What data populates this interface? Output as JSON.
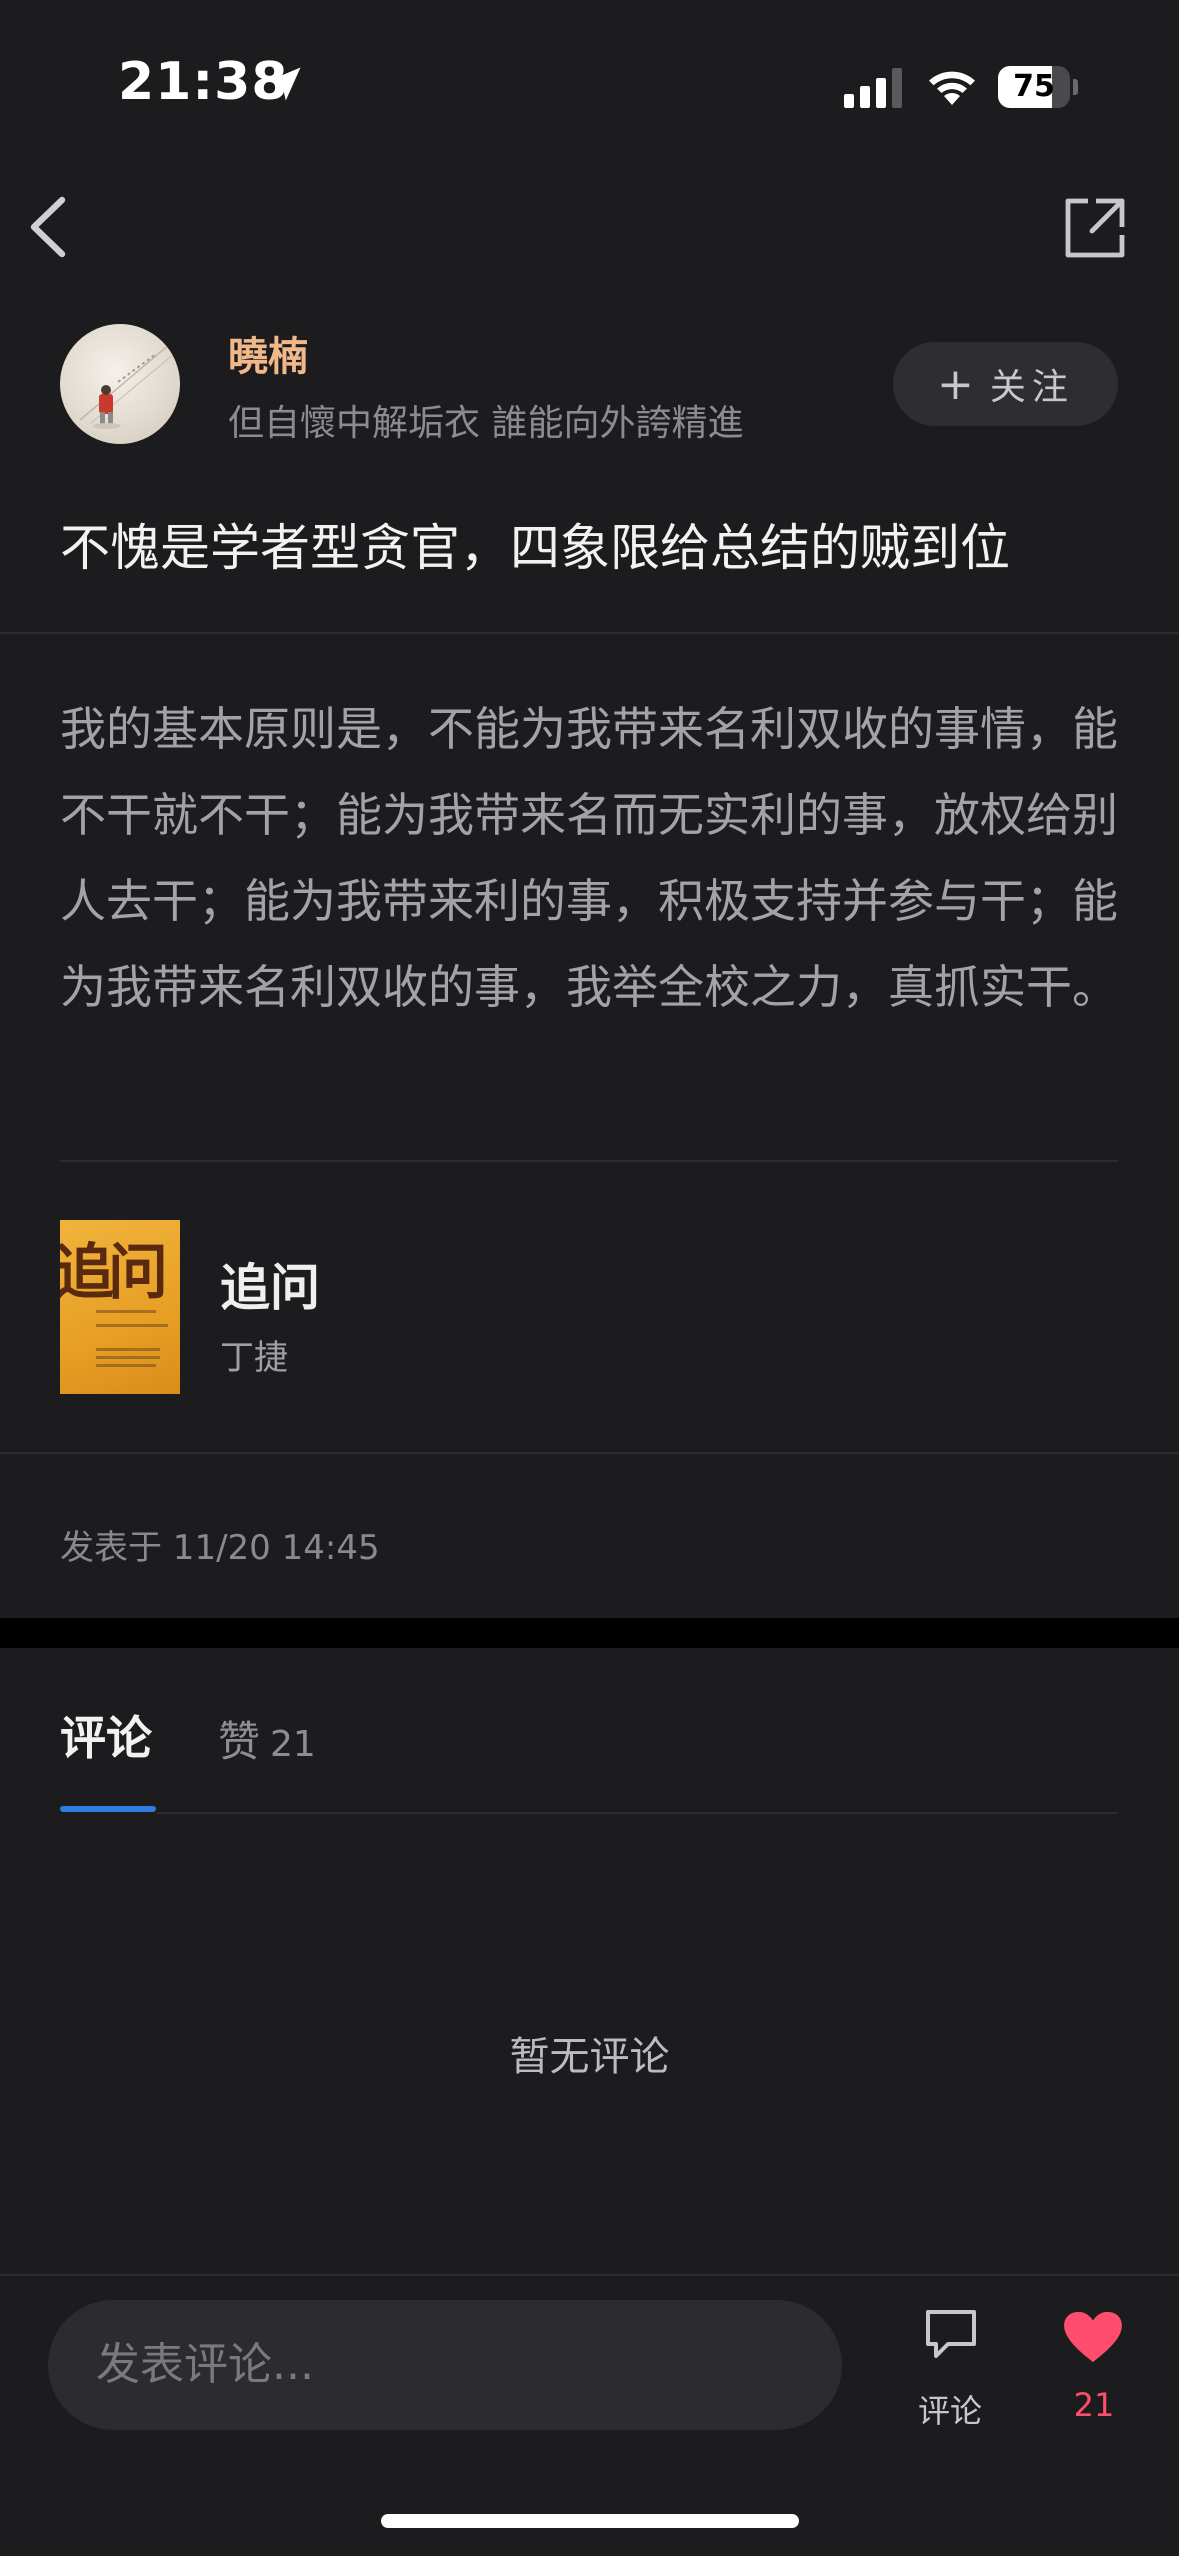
{
  "status_bar": {
    "time": "21:38",
    "battery_percent": 75,
    "battery_text": "75"
  },
  "author": {
    "name": "曉楠",
    "bio": "但自懷中解垢衣 誰能向外誇精進",
    "follow_label": "关注"
  },
  "post": {
    "title": "不愧是学者型贪官，四象限给总结的贼到位",
    "quote": "我的基本原则是，不能为我带来名利双收的事情，能不干就不干；能为我带来名而无实利的事，放权给别人去干；能为我带来利的事，积极支持并参与干；能为我带来名利双收的事，我举全校之力，真抓实干。",
    "published": "发表于 11/20 14:45"
  },
  "book": {
    "title": "追问",
    "author": "丁捷",
    "cover_title": "追问",
    "cover_colors": [
      "#f1b43c",
      "#d98d1a"
    ]
  },
  "tabs": [
    {
      "label": "评论",
      "active": true
    },
    {
      "label": "赞",
      "count": "21",
      "active": false
    }
  ],
  "comments": {
    "empty_text": "暂无评论"
  },
  "bottom_bar": {
    "input_placeholder": "发表评论...",
    "comment_label": "评论",
    "like_count": "21"
  },
  "colors": {
    "background": "#1c1c1e",
    "accent_blue": "#2f7de1",
    "author_name": "#f1b98a",
    "like_red": "#ff4d6d"
  },
  "icons": [
    "location-arrow-icon",
    "cellular-signal-icon",
    "wifi-icon",
    "battery-icon",
    "back-chevron-icon",
    "share-icon",
    "plus-icon",
    "comment-bubble-icon",
    "heart-icon"
  ]
}
